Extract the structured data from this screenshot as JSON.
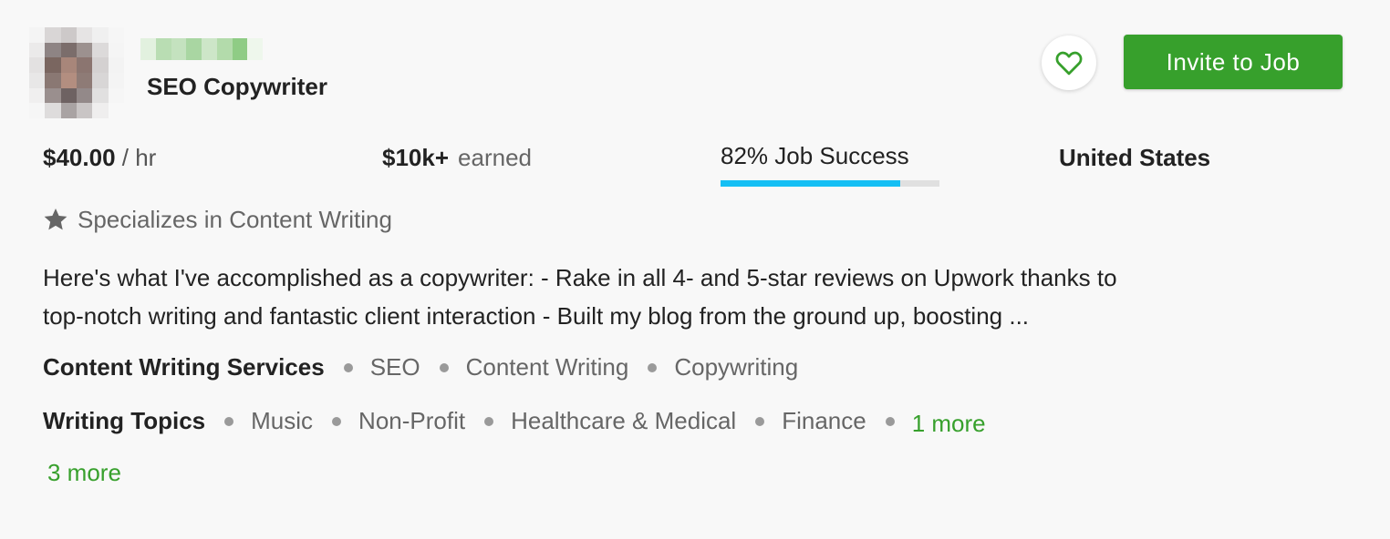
{
  "profile": {
    "title": "SEO Copywriter",
    "rate_amount": "$40.00",
    "rate_unit": "/ hr",
    "earned_amount": "$10k+",
    "earned_label": "earned",
    "job_success_text": "82% Job Success",
    "job_success_percent": 82,
    "country": "United States",
    "specializes": "Specializes in Content Writing",
    "description_line1": "Here's what I've accomplished as a copywriter: - Rake in all 4- and 5-star reviews on Upwork thanks to",
    "description_line2": "top-notch writing and fantastic client interaction - Built my blog from the ground up, boosting ..."
  },
  "actions": {
    "invite_label": "Invite to Job",
    "favorite_icon": "heart-icon"
  },
  "skills": {
    "row1": {
      "category": "Content Writing Services",
      "tags": [
        "SEO",
        "Content Writing",
        "Copywriting"
      ]
    },
    "row2": {
      "category": "Writing Topics",
      "tags": [
        "Music",
        "Non-Profit",
        "Healthcare & Medical",
        "Finance"
      ],
      "more_label": "1 more"
    },
    "more_label": "3 more"
  },
  "colors": {
    "accent_green": "#37a02c",
    "job_success_bar": "#14bff4",
    "background": "#f8f8f8"
  }
}
